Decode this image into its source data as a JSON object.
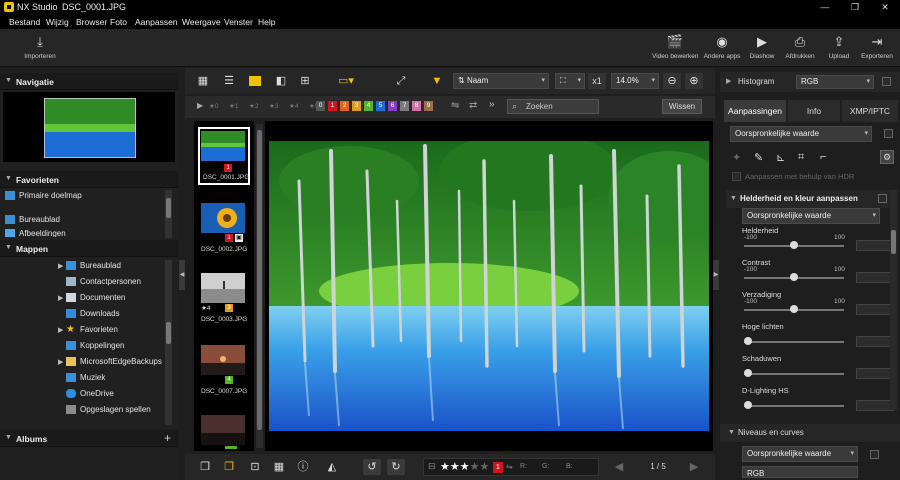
{
  "title": {
    "app": "NX Studio",
    "document": "DSC_0001.JPG"
  },
  "window": {
    "minimize": "—",
    "restore": "❐",
    "close": "✕"
  },
  "menu": [
    "Bestand",
    "Wijzig",
    "Browser",
    "Foto",
    "Aanpassen",
    "Weergave",
    "Venster",
    "Help"
  ],
  "toolbar": {
    "import": "Importeren",
    "video": "Video bewerken",
    "other_apps": "Andere apps",
    "slideshow": "Diashow",
    "print": "Afdrukken",
    "upload": "Upload",
    "export": "Exporteren"
  },
  "left": {
    "navigation": "Navigatie",
    "favorites": "Favorieten",
    "favorites_items": [
      "Primaire doelmap",
      "Bureaublad",
      "Afbeeldingen"
    ],
    "folders": "Mappen",
    "folder_items": [
      "Bureaublad",
      "Contactpersonen",
      "Documenten",
      "Downloads",
      "Favorieten",
      "Koppelingen",
      "MicrosoftEdgeBackups",
      "Muziek",
      "OneDrive",
      "Opgeslagen spellen"
    ],
    "albums": "Albums",
    "albums_add": "+"
  },
  "viewbar": {
    "sort": "Naam",
    "zoom_factor": "x1",
    "zoom_percent": "14.0%"
  },
  "filterbar": {
    "stars": [
      "★0",
      "★1",
      "★2",
      "★3",
      "★4",
      "★5"
    ],
    "labels": [
      "0",
      "1",
      "2",
      "3",
      "4",
      "5",
      "6",
      "7",
      "8",
      "9"
    ],
    "search_placeholder": "Zoeken",
    "clear": "Wissen"
  },
  "thumbnails": [
    {
      "name": "DSC_0001.JPG",
      "badge": "1",
      "badge_color": "#d0151f"
    },
    {
      "name": "DSC_0002.JPG",
      "badge": "1",
      "badge_color": "#d0151f"
    },
    {
      "name": "DSC_0003.JPG",
      "badge": "3",
      "badge_color": "#e39b1d",
      "stars": "★4"
    },
    {
      "name": "DSC_0007.JPG",
      "badge": "4",
      "badge_color": "#57b42a"
    },
    {
      "name": "",
      "badge": "",
      "badge_color": "#57b42a"
    }
  ],
  "bottombar": {
    "color_badge": "1",
    "r": "R:",
    "g": "G:",
    "b": "B:",
    "page": "1 / 5",
    "rating_filled": 3,
    "rating_total": 5
  },
  "right": {
    "histogram": "Histogram",
    "histogram_mode": "RGB",
    "tabs": [
      "Aanpassingen",
      "Info",
      "XMP/IPTC"
    ],
    "preset": "Oorspronkelijke waarde",
    "hdr_label": "Aanpassen met behulp van HDR",
    "section1": "Helderheid en kleur aanpassen",
    "section1_preset": "Oorspronkelijke waarde",
    "sliders": [
      {
        "label": "Helderheid",
        "lo": "-100",
        "hi": "100",
        "value": 0.5
      },
      {
        "label": "Contrast",
        "lo": "-100",
        "hi": "100",
        "value": 0.5
      },
      {
        "label": "Verzadiging",
        "lo": "-100",
        "hi": "100",
        "value": 0.5
      },
      {
        "label": "Hoge lichten",
        "lo": "",
        "hi": "",
        "value": 0
      },
      {
        "label": "Schaduwen",
        "lo": "",
        "hi": "",
        "value": 0
      },
      {
        "label": "D-Lighting HS",
        "lo": "",
        "hi": "",
        "value": 0
      }
    ],
    "section2": "Niveaus en curves",
    "section2_preset": "Oorspronkelijke waarde",
    "section2_mode": "RGB"
  },
  "colors": {
    "accent": "#f2c200",
    "panel_bg": "#202020",
    "tab_active": "#3a3a3a"
  }
}
